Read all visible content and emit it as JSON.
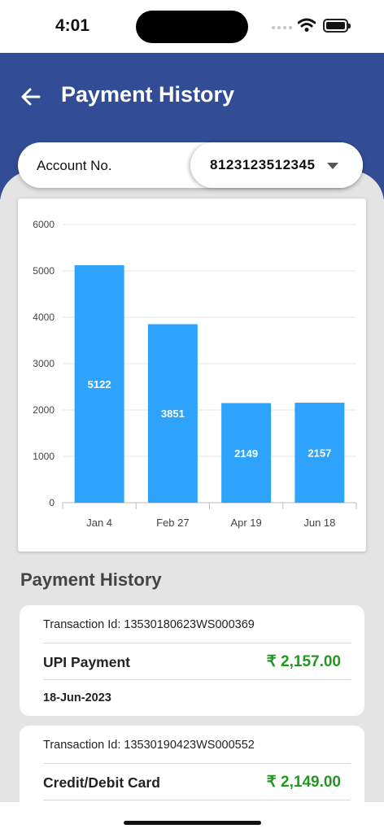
{
  "status_bar": {
    "time": "4:01"
  },
  "header": {
    "title": "Payment History"
  },
  "account": {
    "label": "Account No.",
    "value": "8123123512345"
  },
  "chart_data": {
    "type": "bar",
    "categories": [
      "Jan 4",
      "Feb 27",
      "Apr 19",
      "Jun 18"
    ],
    "values": [
      5122,
      3851,
      2149,
      2157
    ],
    "data_labels": [
      "5122",
      "3851",
      "2149",
      "2157"
    ],
    "yticks": [
      "0",
      "1000",
      "2000",
      "3000",
      "4000",
      "5000",
      "6000"
    ],
    "ylim": [
      0,
      6000
    ],
    "grid": true,
    "bar_color": "#2ea3fb"
  },
  "section_title": "Payment History",
  "transactions": [
    {
      "id_text": "Transaction Id: 13530180623WS000369",
      "type": "UPI Payment",
      "amount": "₹ 2,157.00",
      "date": "18-Jun-2023"
    },
    {
      "id_text": "Transaction Id: 13530190423WS000552",
      "type": "Credit/Debit Card",
      "amount": "₹ 2,149.00"
    }
  ],
  "colors": {
    "header": "#324d95",
    "amount": "#1f9a1f",
    "background": "#e4e4e4"
  }
}
